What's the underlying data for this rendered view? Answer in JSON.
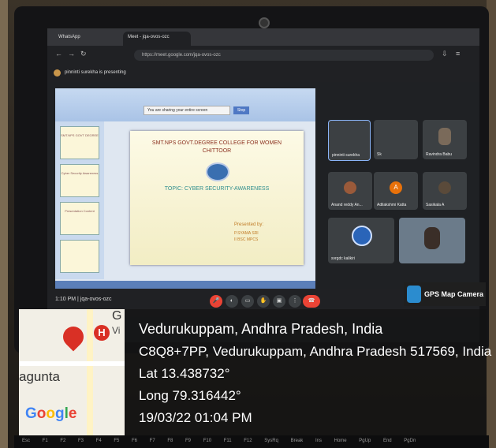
{
  "browser": {
    "tab1_label": "WhatsApp",
    "tab2_label": "Meet - jqa-ovos-ozc",
    "url": "https://meet.google.com/jqa-ovos-ozc"
  },
  "meet": {
    "presenting_banner": "pinninti surekha is presenting",
    "time_and_code": "1:10 PM  |  jqa-ovos-ozc",
    "participants": [
      {
        "name": "pinninti surekha"
      },
      {
        "name": "Sk"
      },
      {
        "name": "Ravindra Babu"
      },
      {
        "name": "Anand reddy An..."
      },
      {
        "name": "Adilakshmi Katta"
      },
      {
        "name": "Sasikala A"
      },
      {
        "name": "svrgdc kalikiri"
      }
    ],
    "participant_letter": "A"
  },
  "slide": {
    "title_line1": "SMT.NPS GOVT.DEGREE COLLEGE   FOR   WOMEN",
    "title_line2": "CHITTOOR",
    "topic": "TOPIC: CYBER SECURITY-AWARENESS",
    "presented_by": "Presented by:",
    "presenter_line1": "P.SYAMA SRI",
    "presenter_line2": "II  BSC  MPCS",
    "notice": "You are sharing your entire screen",
    "stop_label": "Stop",
    "thumb1": "SMT.NPS GOVT DEGREE",
    "thumb2": "Cyber Security Awareness",
    "thumb3": "Presentation Content"
  },
  "gps": {
    "app_label": "GPS Map Camera",
    "place": "Vedurukuppam, Andhra Pradesh, India",
    "address": "C8Q8+7PP, Vedurukuppam, Andhra Pradesh 517569, India",
    "lat": "Lat 13.438732°",
    "long": "Long 79.316442°",
    "datetime": "19/03/22 01:04 PM"
  },
  "map": {
    "town_label": "agunta",
    "corner_letter": "G",
    "corner_letters2": "Vi",
    "h_marker": "H",
    "google": [
      "G",
      "o",
      "o",
      "g",
      "l",
      "e"
    ]
  },
  "keyboard": {
    "keys": "Esc F1 F2 F3 F4 F5 F6 F7 F8 F9 F10 F11 F12 SysRq Break Ins Home PgUp End PgDn"
  }
}
